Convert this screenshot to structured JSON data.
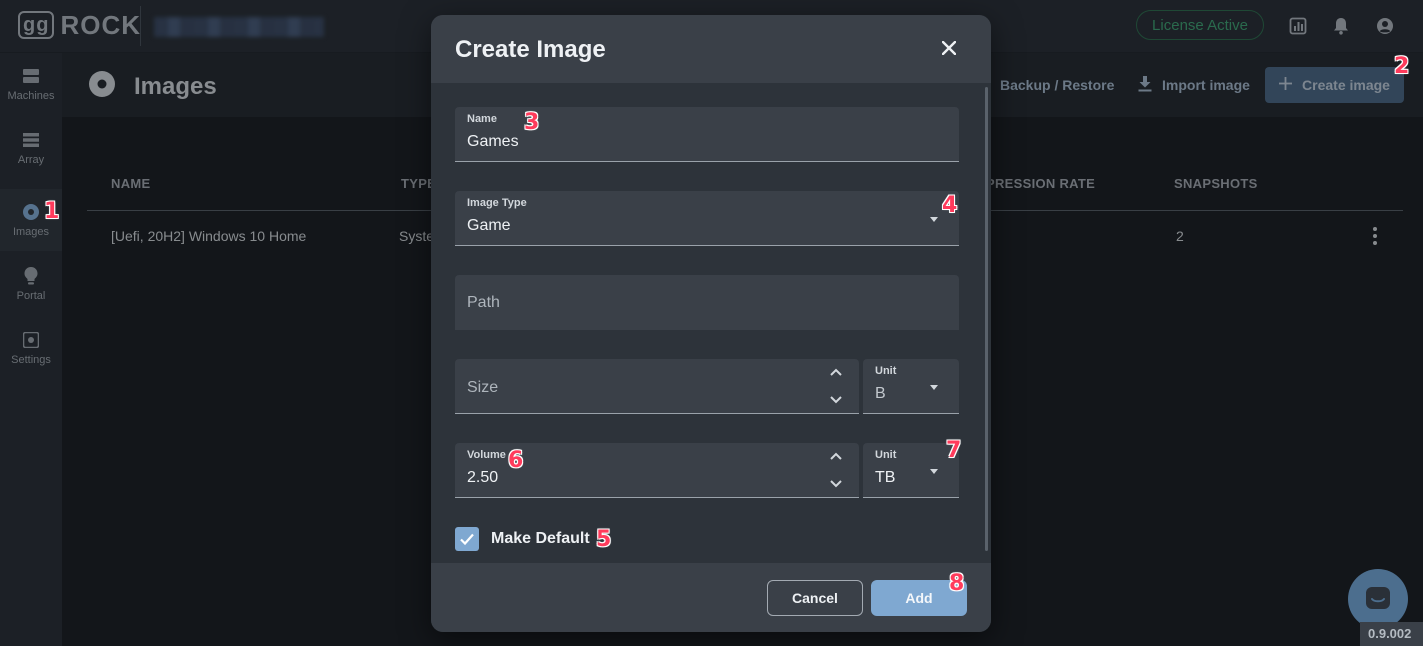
{
  "topbar": {
    "logo_gg": "gg",
    "logo_text": "ROCK",
    "license_label": "License Active",
    "icons": [
      "stats-icon",
      "bell-icon",
      "account-icon"
    ]
  },
  "sidebar": {
    "items": [
      {
        "label": "Machines",
        "icon": "machines-icon"
      },
      {
        "label": "Array",
        "icon": "array-icon"
      },
      {
        "label": "Images",
        "icon": "disc-icon",
        "active": true
      },
      {
        "label": "Portal",
        "icon": "lightbulb-icon"
      },
      {
        "label": "Settings",
        "icon": "settings-icon"
      }
    ]
  },
  "page": {
    "title": "Images",
    "backup_label": "Backup / Restore",
    "import_label": "Import image",
    "create_label": "Create image"
  },
  "table": {
    "headers": {
      "name": "NAME",
      "type": "TYPE",
      "compression": "PRESSION RATE",
      "snapshots": "SNAPSHOTS"
    },
    "rows": [
      {
        "name": "[Uefi, 20H2] Windows 10 Home",
        "type": "Syste",
        "snapshots": "2"
      }
    ]
  },
  "modal": {
    "title": "Create Image",
    "name_label": "Name",
    "name_value": "Games",
    "type_label": "Image Type",
    "type_value": "Game",
    "path_placeholder": "Path",
    "size_placeholder": "Size",
    "size_unit_label": "Unit",
    "size_unit_value": "B",
    "volume_label": "Volume",
    "volume_value": "2.50",
    "volume_unit_label": "Unit",
    "volume_unit_value": "TB",
    "make_default_label": "Make Default",
    "make_default_checked": true,
    "cancel_label": "Cancel",
    "add_label": "Add"
  },
  "markers": [
    "1",
    "2",
    "3",
    "4",
    "5",
    "6",
    "7",
    "8"
  ],
  "version": "0.9.002",
  "colors": {
    "accent": "#7fa8d1",
    "license_green": "#3f9c72",
    "marker_red": "#ff3b5c"
  }
}
